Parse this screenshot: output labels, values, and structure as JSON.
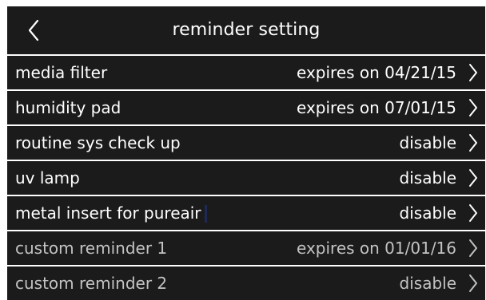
{
  "header": {
    "title": "reminder setting",
    "back_icon": "chevron-left-icon"
  },
  "reminders": [
    {
      "label": "media filter",
      "value": "expires on 04/21/15"
    },
    {
      "label": "humidity pad",
      "value": "expires on 07/01/15"
    },
    {
      "label": "routine sys check up",
      "value": "disable"
    },
    {
      "label": "uv lamp",
      "value": "disable"
    },
    {
      "label": "metal insert for pureair",
      "value": "disable"
    },
    {
      "label": "custom reminder 1",
      "value": "expires on 01/01/16"
    },
    {
      "label": "custom reminder 2",
      "value": "disable"
    }
  ],
  "colors": {
    "panel_background": "#1b1b1b",
    "text_primary": "#ffffff",
    "text_secondary": "#c3c3c3",
    "gap": "#ffffff"
  },
  "row_icon": "chevron-right-icon"
}
